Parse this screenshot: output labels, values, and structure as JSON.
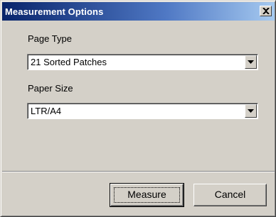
{
  "window": {
    "title": "Measurement Options",
    "close_icon": "close-icon"
  },
  "page_type": {
    "label": "Page Type",
    "selected": "21 Sorted Patches"
  },
  "paper_size": {
    "label": "Paper Size",
    "selected": "LTR/A4"
  },
  "buttons": {
    "measure": "Measure",
    "cancel": "Cancel"
  },
  "colors": {
    "titlebar_start": "#08246b",
    "titlebar_end": "#a6caf0",
    "face": "#d4d0c8"
  }
}
